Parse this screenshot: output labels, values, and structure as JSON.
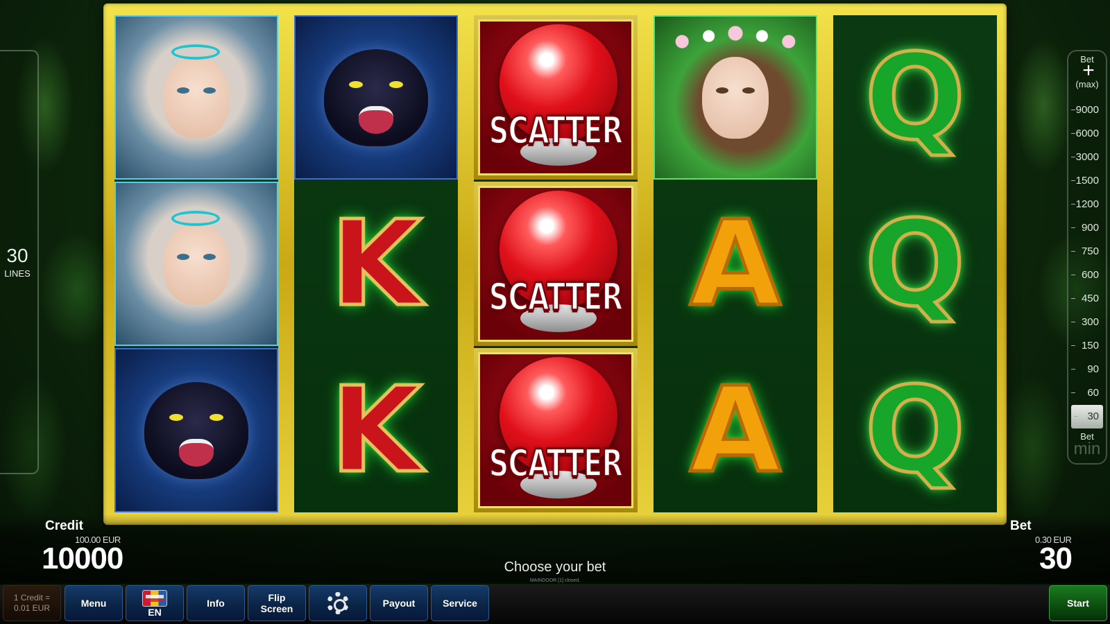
{
  "lines": {
    "value": "30",
    "label": "LINES"
  },
  "reels": [
    [
      {
        "symbol": "fairy-girl-icon"
      },
      {
        "symbol": "fairy-girl-icon"
      },
      {
        "symbol": "panther-icon"
      }
    ],
    [
      {
        "symbol": "panther-icon"
      },
      {
        "symbol": "K"
      },
      {
        "symbol": "K"
      }
    ],
    [
      {
        "symbol": "SCATTER"
      },
      {
        "symbol": "SCATTER"
      },
      {
        "symbol": "SCATTER"
      }
    ],
    [
      {
        "symbol": "flower-girl-icon"
      },
      {
        "symbol": "A"
      },
      {
        "symbol": "A"
      }
    ],
    [
      {
        "symbol": "Q"
      },
      {
        "symbol": "Q"
      },
      {
        "symbol": "Q"
      }
    ]
  ],
  "bet_scale": {
    "top_label": "Bet",
    "plus": "+",
    "max_label": "(max)",
    "values": [
      "9000",
      "6000",
      "3000",
      "1500",
      "1200",
      "900",
      "750",
      "600",
      "450",
      "300",
      "150",
      "90",
      "60",
      "30"
    ],
    "selected": "30",
    "bottom_label": "Bet",
    "min_label": "min"
  },
  "credit": {
    "label": "Credit",
    "eur": "100.00 EUR",
    "value": "10000"
  },
  "bet": {
    "label": "Bet",
    "eur": "0.30 EUR",
    "value": "30"
  },
  "status": {
    "message": "Choose your bet",
    "sub": "MAINDOOR [1] closed."
  },
  "toolbar": {
    "credit_rate_line1": "1 Credit =",
    "credit_rate_line2": "0.01 EUR",
    "menu": "Menu",
    "language": "EN",
    "info": "Info",
    "flip_line1": "Flip",
    "flip_line2": "Screen",
    "payout": "Payout",
    "service": "Service",
    "start": "Start"
  }
}
